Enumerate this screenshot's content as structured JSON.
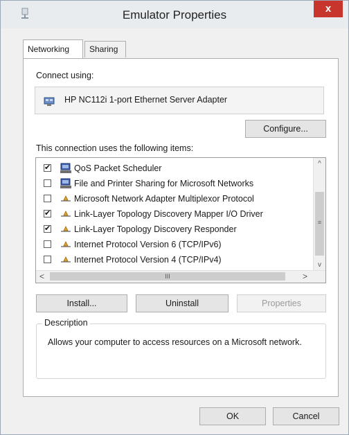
{
  "window": {
    "title": "Emulator Properties",
    "close_glyph": "x",
    "accent_close": "#c7352d"
  },
  "tabs": [
    {
      "label": "Networking",
      "active": true
    },
    {
      "label": "Sharing",
      "active": false
    }
  ],
  "connect": {
    "label": "Connect using:",
    "adapter": "HP NC112i 1-port Ethernet Server Adapter",
    "adapter_icon": "network-adapter-icon"
  },
  "configure_label": "Configure...",
  "items_label": "This connection uses the following items:",
  "items": [
    {
      "label": "QoS Packet Scheduler",
      "checked": true,
      "icon": "network-client-icon"
    },
    {
      "label": "File and Printer Sharing for Microsoft Networks",
      "checked": false,
      "icon": "network-client-icon"
    },
    {
      "label": "Microsoft Network Adapter Multiplexor Protocol",
      "checked": false,
      "icon": "protocol-icon"
    },
    {
      "label": "Link-Layer Topology Discovery Mapper I/O Driver",
      "checked": true,
      "icon": "protocol-icon"
    },
    {
      "label": "Link-Layer Topology Discovery Responder",
      "checked": true,
      "icon": "protocol-icon"
    },
    {
      "label": "Internet Protocol Version 6 (TCP/IPv6)",
      "checked": false,
      "icon": "protocol-icon"
    },
    {
      "label": "Internet Protocol Version 4 (TCP/IPv4)",
      "checked": false,
      "icon": "protocol-icon"
    }
  ],
  "scroll": {
    "up": "^",
    "down": "v",
    "left": "<",
    "right": ">",
    "v_grip": "≡",
    "h_grip": "III"
  },
  "buttons": {
    "install": "Install...",
    "uninstall": "Uninstall",
    "properties": "Properties",
    "ok": "OK",
    "cancel": "Cancel"
  },
  "description": {
    "title": "Description",
    "text": "Allows your computer to access resources on a Microsoft network."
  }
}
